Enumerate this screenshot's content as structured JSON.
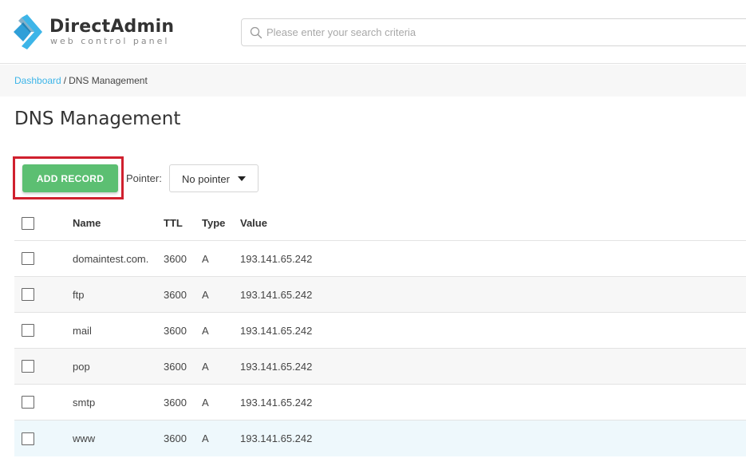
{
  "logo": {
    "title": "DirectAdmin",
    "subtitle": "web control panel",
    "colors": {
      "accent": "#3db5e8",
      "dark": "#1e6f9c"
    }
  },
  "search": {
    "placeholder": "Please enter your search criteria",
    "value": ""
  },
  "breadcrumb": {
    "items": [
      {
        "label": "Dashboard"
      },
      {
        "label": "DNS Management"
      }
    ],
    "separator": "/"
  },
  "page": {
    "title": "DNS Management"
  },
  "toolbar": {
    "add_label": "ADD RECORD",
    "pointer_label": "Pointer:",
    "pointer_value": "No pointer"
  },
  "table": {
    "columns": [
      "Name",
      "TTL",
      "Type",
      "Value"
    ],
    "rows": [
      {
        "name": "domaintest.com.",
        "ttl": "3600",
        "type": "A",
        "value": "193.141.65.242"
      },
      {
        "name": "ftp",
        "ttl": "3600",
        "type": "A",
        "value": "193.141.65.242"
      },
      {
        "name": "mail",
        "ttl": "3600",
        "type": "A",
        "value": "193.141.65.242"
      },
      {
        "name": "pop",
        "ttl": "3600",
        "type": "A",
        "value": "193.141.65.242"
      },
      {
        "name": "smtp",
        "ttl": "3600",
        "type": "A",
        "value": "193.141.65.242"
      },
      {
        "name": "www",
        "ttl": "3600",
        "type": "A",
        "value": "193.141.65.242"
      }
    ]
  },
  "colors": {
    "button_green": "#5cbf72",
    "highlight_red": "#d0202e",
    "link_blue": "#3db5e8"
  }
}
